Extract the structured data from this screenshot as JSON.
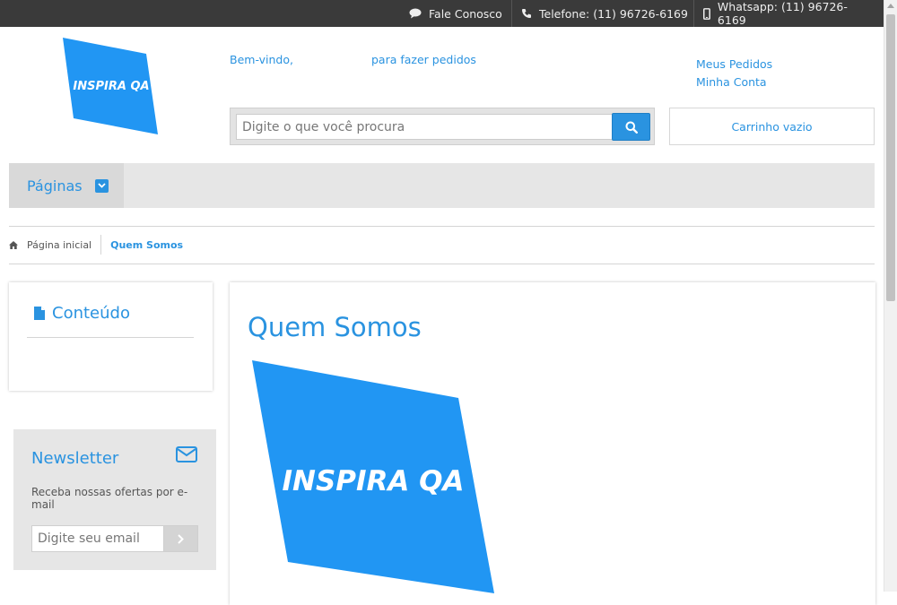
{
  "topbar": {
    "contact_label": "Fale Conosco",
    "phone_label": "Telefone: (11) 96726-6169",
    "whatsapp_label": "Whatsapp: (11) 96726-6169"
  },
  "header": {
    "logo_text": "INSPIRA QA",
    "welcome": "Bem-vindo,",
    "login_prompt": "para fazer pedidos",
    "my_orders": "Meus Pedidos",
    "my_account": "Minha Conta",
    "search_placeholder": "Digite o que você procura",
    "cart_label": "Carrinho vazio"
  },
  "nav": {
    "pages_label": "Páginas"
  },
  "breadcrumb": {
    "home": "Página inicial",
    "current": "Quem Somos"
  },
  "sidebar": {
    "content_title": "Conteúdo",
    "newsletter_title": "Newsletter",
    "newsletter_text": "Receba nossas ofertas por e-mail",
    "newsletter_placeholder": "Digite seu email"
  },
  "main": {
    "title": "Quem Somos",
    "image_text": "INSPIRA QA"
  },
  "colors": {
    "accent": "#2a93e0",
    "logo_blue": "#2196f3",
    "topbar": "#3a3a3a"
  }
}
